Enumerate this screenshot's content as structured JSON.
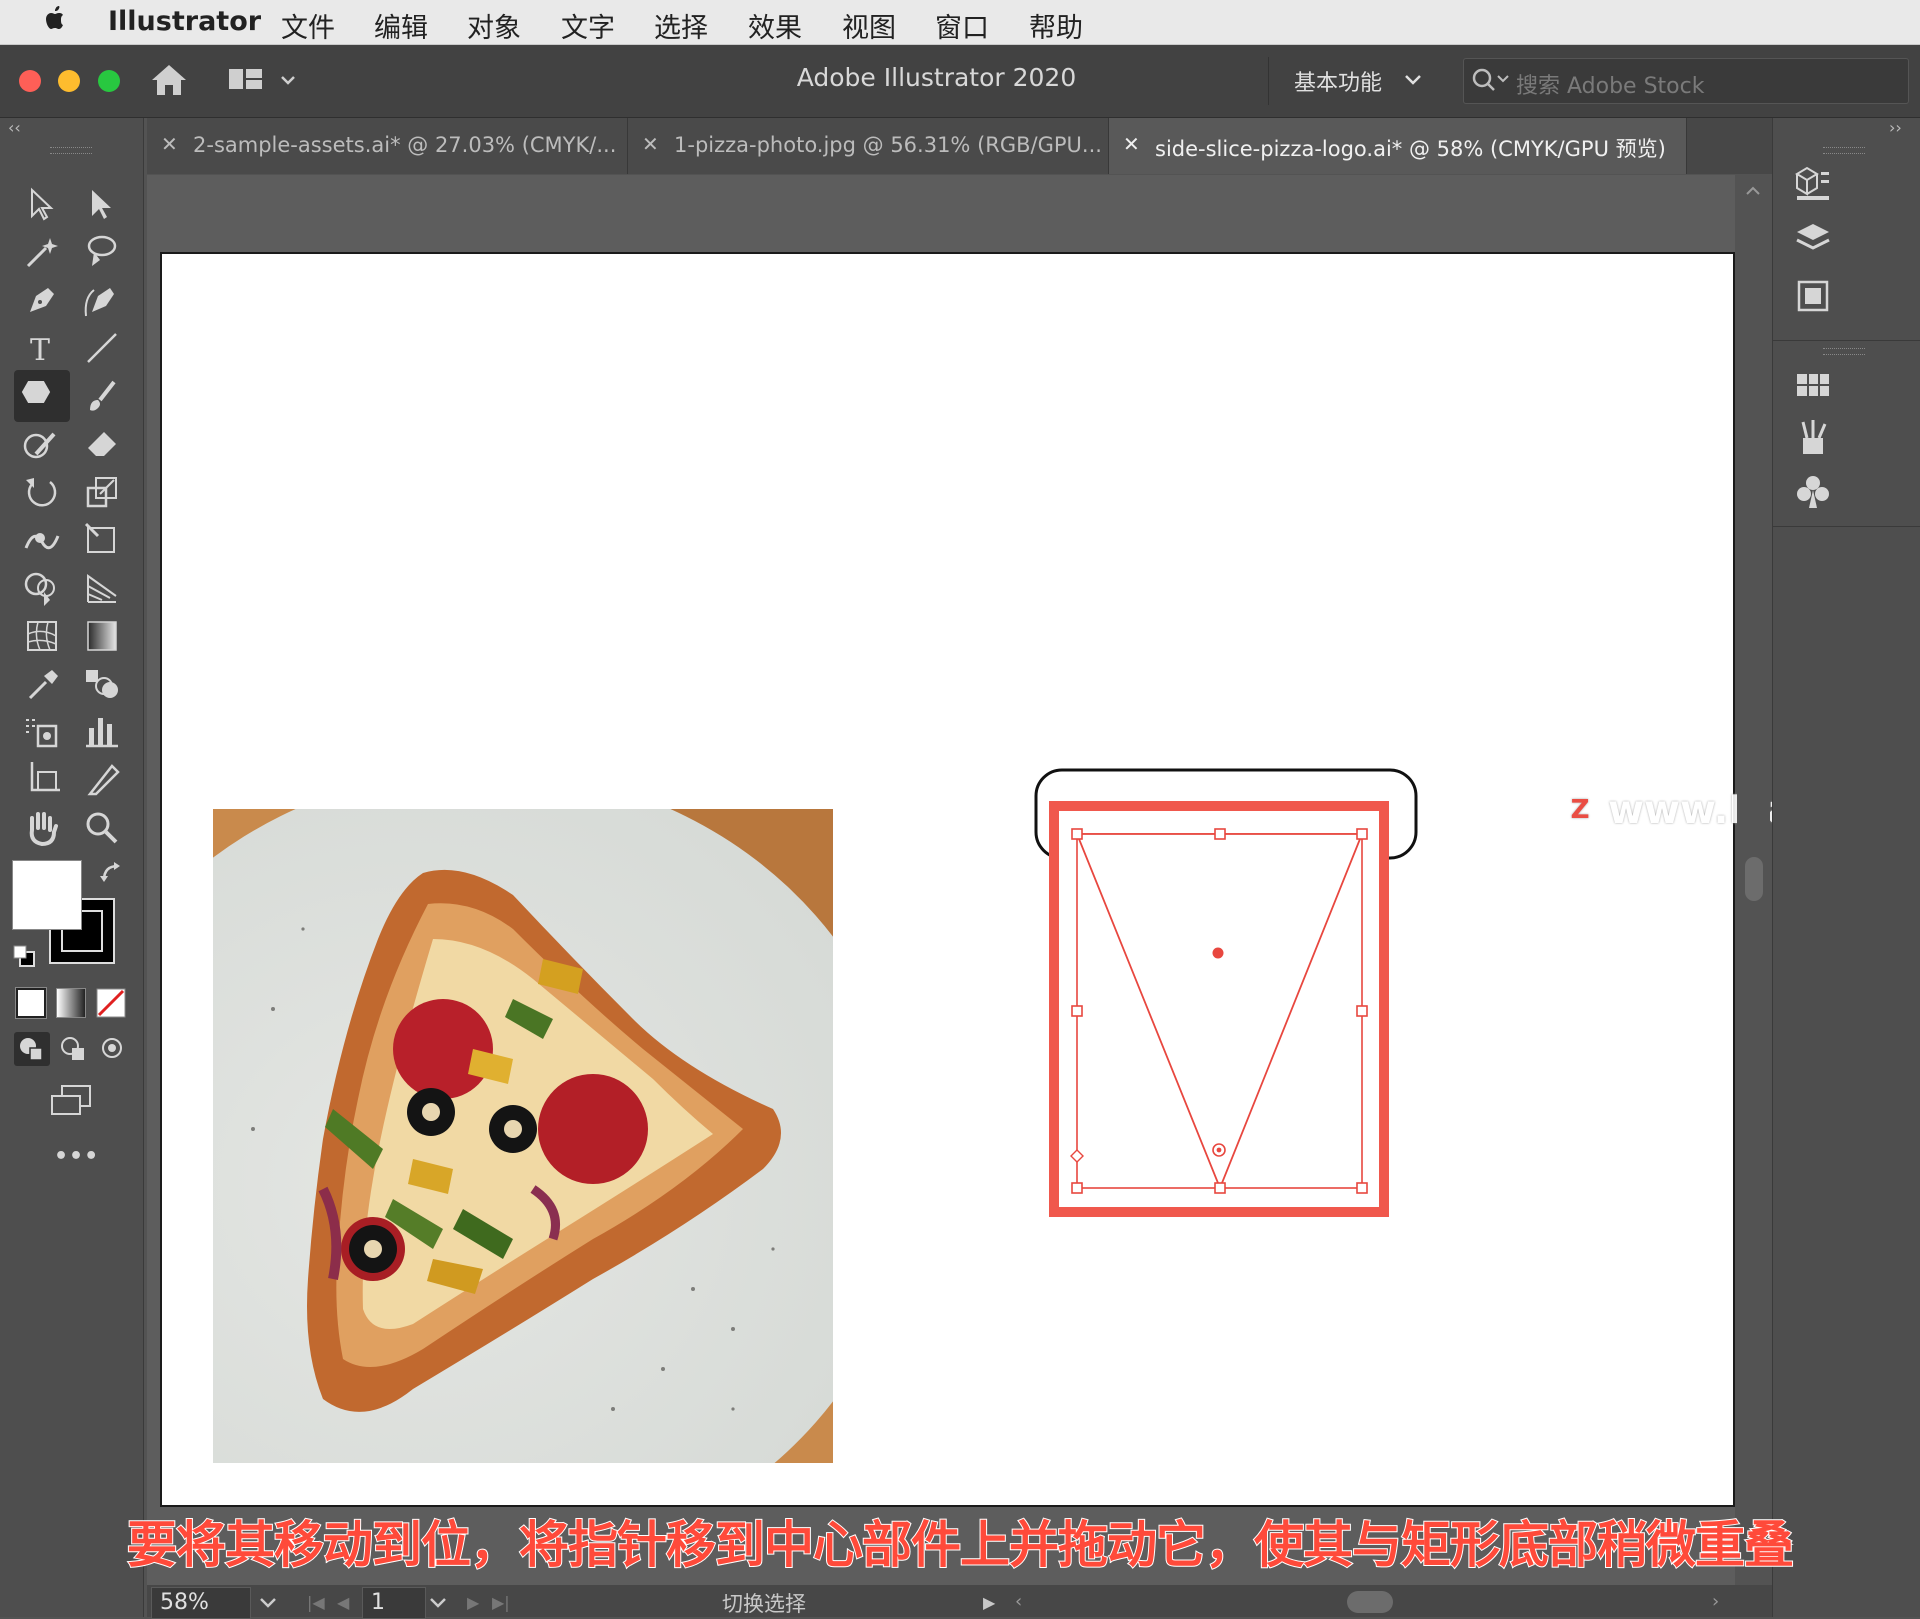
{
  "menubar": {
    "app_name": "Illustrator",
    "items": [
      "文件",
      "编辑",
      "对象",
      "文字",
      "选择",
      "效果",
      "视图",
      "窗口",
      "帮助"
    ]
  },
  "window": {
    "title": "Adobe Illustrator 2020",
    "workspace_label": "基本功能",
    "search_placeholder": "搜索 Adobe Stock"
  },
  "tabs": [
    {
      "label": "2-sample-assets.ai* @ 27.03% (CMYK/...",
      "active": false
    },
    {
      "label": "1-pizza-photo.jpg @ 56.31% (RGB/GPU...",
      "active": false
    },
    {
      "label": "side-slice-pizza-logo.ai* @ 58% (CMYK/GPU 预览)",
      "active": true
    }
  ],
  "tools": {
    "more_label": "•••"
  },
  "statusbar": {
    "zoom": "58%",
    "artboard_number": "1",
    "status_text": "切换选择"
  },
  "caption": "要将其移动到位，将指针移到中心部件上并拖动它，使其与矩形底部稍微重叠",
  "watermark": "www.MacZ.com",
  "colors": {
    "accent": "#ff5a4e",
    "selection": "#e8473f"
  }
}
